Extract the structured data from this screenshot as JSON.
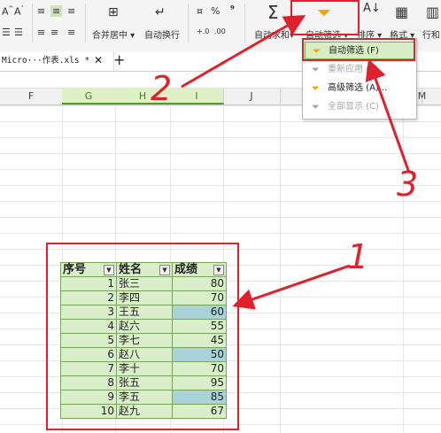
{
  "ribbon": {
    "font_btns": [
      "A^",
      "A˅"
    ],
    "merge_label": "合并居中 ▾",
    "wrap_label": "自动换行",
    "percent": "%",
    "comma": "⁹",
    "dec_inc": "+.0",
    "dec_dec": ".00",
    "autosum_label": "自动求和▾",
    "autofilter_label": "自动筛选 ▾",
    "sort_label": "排序 ▾",
    "format_label": "格式 ▾",
    "row_label": "行和"
  },
  "tab": {
    "title": "Micro···作表.xls *",
    "close": "✕",
    "add": "+"
  },
  "columns": [
    "F",
    "G",
    "H",
    "I",
    "J",
    "M"
  ],
  "dropdown": {
    "items": [
      {
        "label": "自动筛选 (F)",
        "state": "active"
      },
      {
        "label": "重新应用 (Y)",
        "state": "disabled"
      },
      {
        "label": "高级筛选 (A)...",
        "state": "normal"
      },
      {
        "label": "全部显示 (C)",
        "state": "disabled"
      }
    ]
  },
  "table": {
    "headers": [
      "序号",
      "姓名",
      "成绩"
    ],
    "rows": [
      {
        "n": "1",
        "name": "张三",
        "score": "80"
      },
      {
        "n": "2",
        "name": "李四",
        "score": "70"
      },
      {
        "n": "3",
        "name": "王五",
        "score": "60"
      },
      {
        "n": "4",
        "name": "赵六",
        "score": "55"
      },
      {
        "n": "5",
        "name": "李七",
        "score": "45"
      },
      {
        "n": "6",
        "name": "赵八",
        "score": "50"
      },
      {
        "n": "7",
        "name": "李十",
        "score": "70"
      },
      {
        "n": "8",
        "name": "张五",
        "score": "95"
      },
      {
        "n": "9",
        "name": "李五",
        "score": "85"
      },
      {
        "n": "10",
        "name": "赵九",
        "score": "67"
      }
    ]
  },
  "annotations": [
    "2",
    "3",
    "1"
  ],
  "colors": {
    "accent_green": "#4f9a2c",
    "highlight_red": "#e0202a",
    "cell_green": "#d9efc9",
    "cell_blue": "#a9d2d9"
  }
}
